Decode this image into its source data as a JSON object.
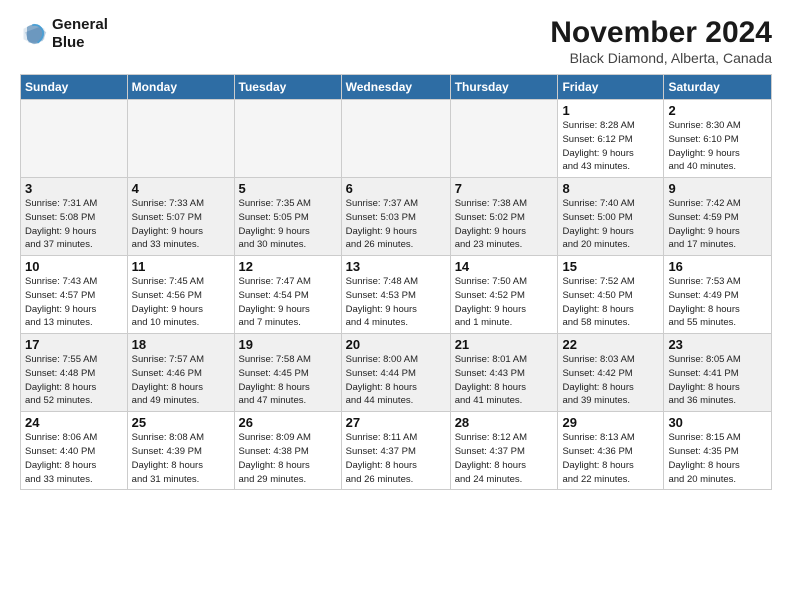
{
  "logo": {
    "line1": "General",
    "line2": "Blue"
  },
  "title": "November 2024",
  "subtitle": "Black Diamond, Alberta, Canada",
  "weekdays": [
    "Sunday",
    "Monday",
    "Tuesday",
    "Wednesday",
    "Thursday",
    "Friday",
    "Saturday"
  ],
  "weeks": [
    [
      {
        "day": "",
        "info": ""
      },
      {
        "day": "",
        "info": ""
      },
      {
        "day": "",
        "info": ""
      },
      {
        "day": "",
        "info": ""
      },
      {
        "day": "",
        "info": ""
      },
      {
        "day": "1",
        "info": "Sunrise: 8:28 AM\nSunset: 6:12 PM\nDaylight: 9 hours\nand 43 minutes."
      },
      {
        "day": "2",
        "info": "Sunrise: 8:30 AM\nSunset: 6:10 PM\nDaylight: 9 hours\nand 40 minutes."
      }
    ],
    [
      {
        "day": "3",
        "info": "Sunrise: 7:31 AM\nSunset: 5:08 PM\nDaylight: 9 hours\nand 37 minutes."
      },
      {
        "day": "4",
        "info": "Sunrise: 7:33 AM\nSunset: 5:07 PM\nDaylight: 9 hours\nand 33 minutes."
      },
      {
        "day": "5",
        "info": "Sunrise: 7:35 AM\nSunset: 5:05 PM\nDaylight: 9 hours\nand 30 minutes."
      },
      {
        "day": "6",
        "info": "Sunrise: 7:37 AM\nSunset: 5:03 PM\nDaylight: 9 hours\nand 26 minutes."
      },
      {
        "day": "7",
        "info": "Sunrise: 7:38 AM\nSunset: 5:02 PM\nDaylight: 9 hours\nand 23 minutes."
      },
      {
        "day": "8",
        "info": "Sunrise: 7:40 AM\nSunset: 5:00 PM\nDaylight: 9 hours\nand 20 minutes."
      },
      {
        "day": "9",
        "info": "Sunrise: 7:42 AM\nSunset: 4:59 PM\nDaylight: 9 hours\nand 17 minutes."
      }
    ],
    [
      {
        "day": "10",
        "info": "Sunrise: 7:43 AM\nSunset: 4:57 PM\nDaylight: 9 hours\nand 13 minutes."
      },
      {
        "day": "11",
        "info": "Sunrise: 7:45 AM\nSunset: 4:56 PM\nDaylight: 9 hours\nand 10 minutes."
      },
      {
        "day": "12",
        "info": "Sunrise: 7:47 AM\nSunset: 4:54 PM\nDaylight: 9 hours\nand 7 minutes."
      },
      {
        "day": "13",
        "info": "Sunrise: 7:48 AM\nSunset: 4:53 PM\nDaylight: 9 hours\nand 4 minutes."
      },
      {
        "day": "14",
        "info": "Sunrise: 7:50 AM\nSunset: 4:52 PM\nDaylight: 9 hours\nand 1 minute."
      },
      {
        "day": "15",
        "info": "Sunrise: 7:52 AM\nSunset: 4:50 PM\nDaylight: 8 hours\nand 58 minutes."
      },
      {
        "day": "16",
        "info": "Sunrise: 7:53 AM\nSunset: 4:49 PM\nDaylight: 8 hours\nand 55 minutes."
      }
    ],
    [
      {
        "day": "17",
        "info": "Sunrise: 7:55 AM\nSunset: 4:48 PM\nDaylight: 8 hours\nand 52 minutes."
      },
      {
        "day": "18",
        "info": "Sunrise: 7:57 AM\nSunset: 4:46 PM\nDaylight: 8 hours\nand 49 minutes."
      },
      {
        "day": "19",
        "info": "Sunrise: 7:58 AM\nSunset: 4:45 PM\nDaylight: 8 hours\nand 47 minutes."
      },
      {
        "day": "20",
        "info": "Sunrise: 8:00 AM\nSunset: 4:44 PM\nDaylight: 8 hours\nand 44 minutes."
      },
      {
        "day": "21",
        "info": "Sunrise: 8:01 AM\nSunset: 4:43 PM\nDaylight: 8 hours\nand 41 minutes."
      },
      {
        "day": "22",
        "info": "Sunrise: 8:03 AM\nSunset: 4:42 PM\nDaylight: 8 hours\nand 39 minutes."
      },
      {
        "day": "23",
        "info": "Sunrise: 8:05 AM\nSunset: 4:41 PM\nDaylight: 8 hours\nand 36 minutes."
      }
    ],
    [
      {
        "day": "24",
        "info": "Sunrise: 8:06 AM\nSunset: 4:40 PM\nDaylight: 8 hours\nand 33 minutes."
      },
      {
        "day": "25",
        "info": "Sunrise: 8:08 AM\nSunset: 4:39 PM\nDaylight: 8 hours\nand 31 minutes."
      },
      {
        "day": "26",
        "info": "Sunrise: 8:09 AM\nSunset: 4:38 PM\nDaylight: 8 hours\nand 29 minutes."
      },
      {
        "day": "27",
        "info": "Sunrise: 8:11 AM\nSunset: 4:37 PM\nDaylight: 8 hours\nand 26 minutes."
      },
      {
        "day": "28",
        "info": "Sunrise: 8:12 AM\nSunset: 4:37 PM\nDaylight: 8 hours\nand 24 minutes."
      },
      {
        "day": "29",
        "info": "Sunrise: 8:13 AM\nSunset: 4:36 PM\nDaylight: 8 hours\nand 22 minutes."
      },
      {
        "day": "30",
        "info": "Sunrise: 8:15 AM\nSunset: 4:35 PM\nDaylight: 8 hours\nand 20 minutes."
      }
    ]
  ]
}
